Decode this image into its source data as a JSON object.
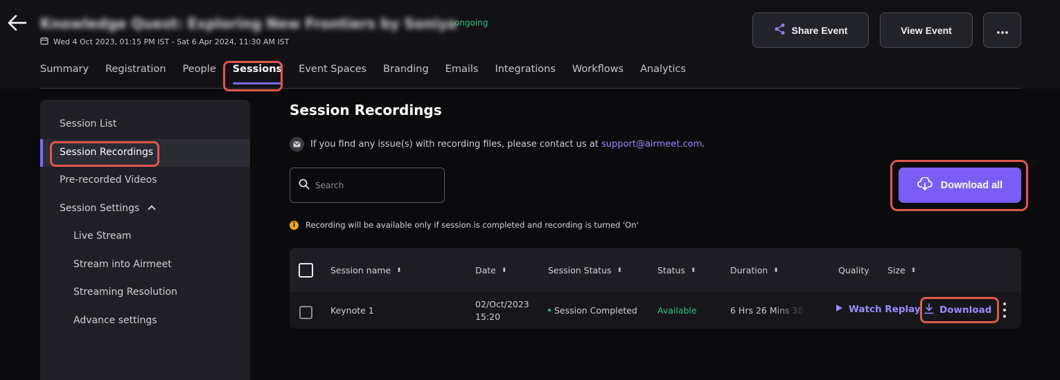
{
  "header": {
    "event_title": "Knowledge Quest: Exploring New Frontiers by Soniya",
    "status": "ongoing",
    "date_range": "Wed 4 Oct 2023, 01:15 PM IST - Sat 6 Apr 2024, 11:30 AM IST",
    "share_label": "Share Event",
    "view_label": "View Event"
  },
  "tabs": [
    {
      "label": "Summary"
    },
    {
      "label": "Registration"
    },
    {
      "label": "People"
    },
    {
      "label": "Sessions"
    },
    {
      "label": "Event Spaces"
    },
    {
      "label": "Branding"
    },
    {
      "label": "Emails"
    },
    {
      "label": "Integrations"
    },
    {
      "label": "Workflows"
    },
    {
      "label": "Analytics"
    }
  ],
  "sidebar": {
    "items": [
      {
        "label": "Session List"
      },
      {
        "label": "Session Recordings"
      },
      {
        "label": "Pre-recorded Videos"
      },
      {
        "label": "Session Settings"
      },
      {
        "label": "Live Stream"
      },
      {
        "label": "Stream into Airmeet"
      },
      {
        "label": "Streaming Resolution"
      },
      {
        "label": "Advance settings"
      }
    ]
  },
  "main": {
    "title": "Session Recordings",
    "info_text": "If you find any issue(s) with recording files, please contact us at",
    "support_email": "support@airmeet.com",
    "info_suffix": ".",
    "search_placeholder": "Search",
    "download_all_label": "Download all",
    "notice": "Recording will be available only if session is completed and recording is turned 'On'",
    "notice_icon": "i"
  },
  "table": {
    "columns": [
      "Session name",
      "Date",
      "Session Status",
      "Status",
      "Duration",
      "Quality",
      "Size"
    ],
    "rows": [
      {
        "session_name": "Keynote 1",
        "date_line1": "02/Oct/2023",
        "date_line2": "15:20",
        "session_status": "Session Completed",
        "status": "Available",
        "duration": "6 Hrs 26 Mins 38",
        "watch_label": "Watch Replay",
        "download_label": "Download"
      }
    ]
  },
  "colors": {
    "accent": "#7b5cf5",
    "link": "#9a8cff",
    "success": "#31c27c",
    "highlight": "#e2574c"
  }
}
